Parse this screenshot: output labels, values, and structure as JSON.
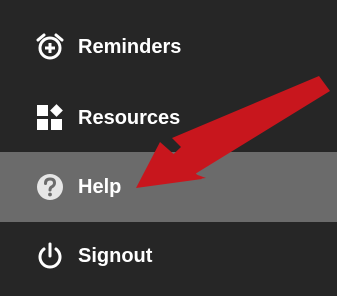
{
  "menu": {
    "items": [
      {
        "label": "Reminders",
        "icon": "alarm-clock-add-icon",
        "active": false
      },
      {
        "label": "Resources",
        "icon": "resources-blocks-icon",
        "active": false
      },
      {
        "label": "Help",
        "icon": "question-circle-icon",
        "active": true
      },
      {
        "label": "Signout",
        "icon": "power-icon",
        "active": false
      }
    ]
  },
  "colors": {
    "background": "#262626",
    "active_row": "#6b6b6b",
    "text": "#ffffff",
    "arrow": "#c8161d"
  }
}
